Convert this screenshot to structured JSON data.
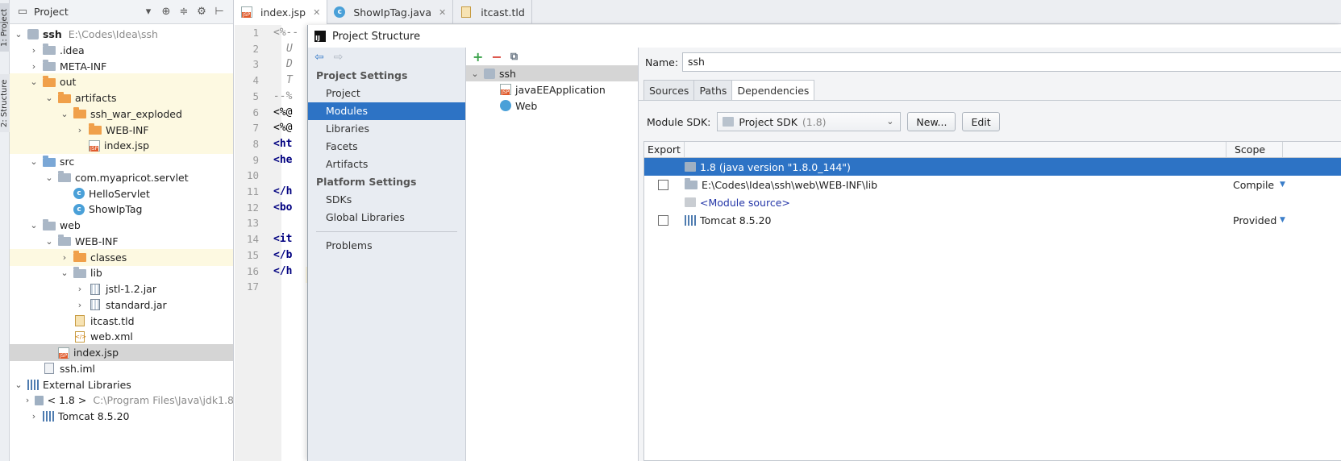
{
  "stripe": {
    "project_tab": "1: Project",
    "structure_tab": "2: Structure"
  },
  "project_panel": {
    "title": "Project",
    "header_icons": [
      "chevron-down-icon",
      "target-icon",
      "collapse-icon",
      "gear-icon",
      "hide-icon"
    ],
    "tree": [
      {
        "label": "ssh",
        "hint": "E:\\Codes\\Idea\\ssh",
        "icon": "module-icon",
        "depth": 0,
        "arrow": "expanded",
        "bold": true,
        "state": ""
      },
      {
        "label": ".idea",
        "icon": "folder-icon",
        "depth": 1,
        "arrow": "collapsed",
        "state": ""
      },
      {
        "label": "META-INF",
        "icon": "folder-icon",
        "depth": 1,
        "arrow": "collapsed",
        "state": ""
      },
      {
        "label": "out",
        "icon": "folder-orange-icon",
        "depth": 1,
        "arrow": "expanded",
        "state": "excluded"
      },
      {
        "label": "artifacts",
        "icon": "folder-orange-icon",
        "depth": 2,
        "arrow": "expanded",
        "state": "excluded"
      },
      {
        "label": "ssh_war_exploded",
        "icon": "folder-orange-icon",
        "depth": 3,
        "arrow": "expanded",
        "state": "excluded"
      },
      {
        "label": "WEB-INF",
        "icon": "folder-orange-icon",
        "depth": 4,
        "arrow": "collapsed",
        "state": "excluded"
      },
      {
        "label": "index.jsp",
        "icon": "jsp-icon",
        "depth": 4,
        "arrow": "none",
        "state": "excluded"
      },
      {
        "label": "src",
        "icon": "folder-blue-icon",
        "depth": 1,
        "arrow": "expanded",
        "state": ""
      },
      {
        "label": "com.myapricot.servlet",
        "icon": "package-icon",
        "depth": 2,
        "arrow": "expanded",
        "state": ""
      },
      {
        "label": "HelloServlet",
        "icon": "class-icon",
        "depth": 3,
        "arrow": "none",
        "state": ""
      },
      {
        "label": "ShowIpTag",
        "icon": "class-icon",
        "depth": 3,
        "arrow": "none",
        "state": ""
      },
      {
        "label": "web",
        "icon": "folder-icon",
        "depth": 1,
        "arrow": "expanded",
        "state": ""
      },
      {
        "label": "WEB-INF",
        "icon": "folder-icon",
        "depth": 2,
        "arrow": "expanded",
        "state": ""
      },
      {
        "label": "classes",
        "icon": "folder-orange-icon",
        "depth": 3,
        "arrow": "collapsed",
        "state": "excluded"
      },
      {
        "label": "lib",
        "icon": "folder-icon",
        "depth": 3,
        "arrow": "expanded",
        "state": ""
      },
      {
        "label": "jstl-1.2.jar",
        "icon": "jar-icon",
        "depth": 4,
        "arrow": "collapsed",
        "state": ""
      },
      {
        "label": "standard.jar",
        "icon": "jar-icon",
        "depth": 4,
        "arrow": "collapsed",
        "state": ""
      },
      {
        "label": "itcast.tld",
        "icon": "tld-icon",
        "depth": 3,
        "arrow": "none",
        "state": ""
      },
      {
        "label": "web.xml",
        "icon": "xml-icon",
        "depth": 3,
        "arrow": "none",
        "state": ""
      },
      {
        "label": "index.jsp",
        "icon": "jsp-icon",
        "depth": 2,
        "arrow": "none",
        "state": "selected"
      },
      {
        "label": "ssh.iml",
        "icon": "iml-icon",
        "depth": 1,
        "arrow": "none",
        "state": ""
      },
      {
        "label": "External Libraries",
        "icon": "library-icon",
        "depth": 0,
        "arrow": "expanded",
        "state": ""
      },
      {
        "label": "< 1.8 >",
        "hint": "C:\\Program Files\\Java\\jdk1.8",
        "icon": "sdk-icon",
        "depth": 1,
        "arrow": "collapsed",
        "state": ""
      },
      {
        "label": "Tomcat 8.5.20",
        "icon": "library-icon",
        "depth": 1,
        "arrow": "collapsed",
        "state": ""
      }
    ]
  },
  "editor": {
    "tabs": [
      {
        "label": "index.jsp",
        "icon": "jsp-icon",
        "active": true,
        "closable": true
      },
      {
        "label": "ShowIpTag.java",
        "icon": "class-icon",
        "active": false,
        "closable": true
      },
      {
        "label": "itcast.tld",
        "icon": "tld-icon",
        "active": false,
        "closable": false
      }
    ],
    "line_numbers": [
      "1",
      "2",
      "3",
      "4",
      "5",
      "6",
      "7",
      "8",
      "9",
      "10",
      "11",
      "12",
      "13",
      "14",
      "15",
      "16",
      "17"
    ],
    "code_lines": [
      {
        "text": "<%--",
        "kind": "comment"
      },
      {
        "text": "U",
        "kind": "comment"
      },
      {
        "text": "D",
        "kind": "comment"
      },
      {
        "text": "T",
        "kind": "comment"
      },
      {
        "text": "--%",
        "kind": "comment"
      },
      {
        "text": "<%@",
        "kind": "dir"
      },
      {
        "text": "<%@",
        "kind": "dir"
      },
      {
        "text": "<ht",
        "kind": "tag"
      },
      {
        "text": "<he",
        "kind": "tag"
      },
      {
        "text": "",
        "kind": "dir"
      },
      {
        "text": "</h",
        "kind": "tag"
      },
      {
        "text": "<bo",
        "kind": "tag"
      },
      {
        "text": "",
        "kind": "dir"
      },
      {
        "text": "<it",
        "kind": "tag"
      },
      {
        "text": "</b",
        "kind": "tag"
      },
      {
        "text": "</h",
        "kind": "tag"
      },
      {
        "text": "",
        "kind": "dir"
      }
    ]
  },
  "dialog": {
    "title": "Project Structure",
    "nav": {
      "project_settings_heading": "Project Settings",
      "project_settings": [
        "Project",
        "Modules",
        "Libraries",
        "Facets",
        "Artifacts"
      ],
      "selected": "Modules",
      "platform_settings_heading": "Platform Settings",
      "platform_settings": [
        "SDKs",
        "Global Libraries"
      ],
      "problems": "Problems"
    },
    "modules_tree": [
      {
        "label": "ssh",
        "icon": "module-icon",
        "depth": 0,
        "selected": true
      },
      {
        "label": "javaEEApplication",
        "icon": "javaee-facet-icon",
        "depth": 1,
        "selected": false
      },
      {
        "label": "Web",
        "icon": "web-facet-icon",
        "depth": 1,
        "selected": false
      }
    ],
    "name_label": "Name:",
    "name_value": "ssh",
    "tabs": [
      "Sources",
      "Paths",
      "Dependencies"
    ],
    "active_tab": "Dependencies",
    "sdk_label": "Module SDK:",
    "sdk_value": "Project SDK",
    "sdk_version": "(1.8)",
    "new_button": "New...",
    "edit_button": "Edit",
    "table": {
      "col_export": "Export",
      "col_scope": "Scope",
      "rows": [
        {
          "name": "1.8 (java version \"1.8.0_144\")",
          "icon": "sdk-icon",
          "scope": "",
          "checkbox": false,
          "selected": true,
          "link": false
        },
        {
          "name": "E:\\Codes\\Idea\\ssh\\web\\WEB-INF\\lib",
          "icon": "folder-icon",
          "scope": "Compile",
          "checkbox": true,
          "selected": false,
          "link": false
        },
        {
          "name": "<Module source>",
          "icon": "module-source-icon",
          "scope": "",
          "checkbox": false,
          "selected": false,
          "link": true
        },
        {
          "name": "Tomcat 8.5.20",
          "icon": "library-icon",
          "scope": "Provided",
          "checkbox": true,
          "selected": false,
          "link": false
        }
      ]
    }
  },
  "colors": {
    "selection": "#2d73c5",
    "excluded_bg": "#fdf9e1",
    "tree_selected": "#d5d5d5"
  }
}
